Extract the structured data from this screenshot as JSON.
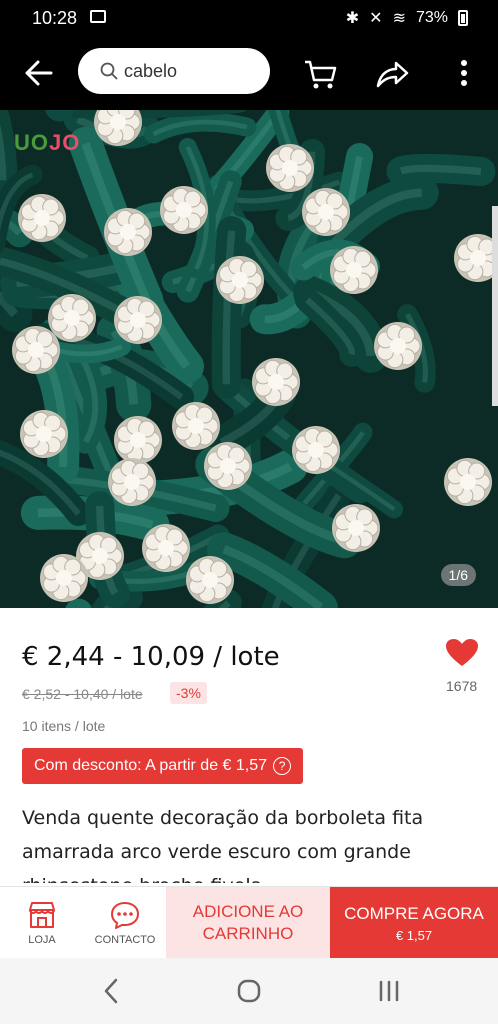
{
  "status_bar": {
    "time": "10:28",
    "battery": "73%"
  },
  "search": {
    "placeholder": "cabelo"
  },
  "hero": {
    "logo_part1": "UO",
    "logo_part2": "JO",
    "pager": "1/6"
  },
  "product": {
    "price": "€ 2,44 - 10,09 / lote",
    "old_price": "€ 2,52 - 10,40 / lote",
    "discount": "-3%",
    "likes": "1678",
    "lot_info": "10 itens / lote",
    "coupon": "Com desconto: A partir de € 1,57",
    "coupon_help": "?",
    "title": "Venda quente decoração da borboleta fita amarrada arco verde escuro com grande rhinsestone broche fivela"
  },
  "actions": {
    "store_label": "LOJA",
    "contact_label": "CONTACTO",
    "add_to_cart": "ADICIONE AO CARRINHO",
    "buy_now": "COMPRE AGORA",
    "buy_now_price": "€ 1,57"
  },
  "colors": {
    "accent": "#e53935",
    "accent_light": "#fde4e4",
    "ribbon": "#0f4a40"
  },
  "icons": [
    "back-icon",
    "search-icon",
    "cart-icon",
    "share-icon",
    "more-icon",
    "heart-icon",
    "store-icon",
    "chat-icon",
    "nav-back-icon",
    "nav-home-icon",
    "nav-recent-icon"
  ]
}
